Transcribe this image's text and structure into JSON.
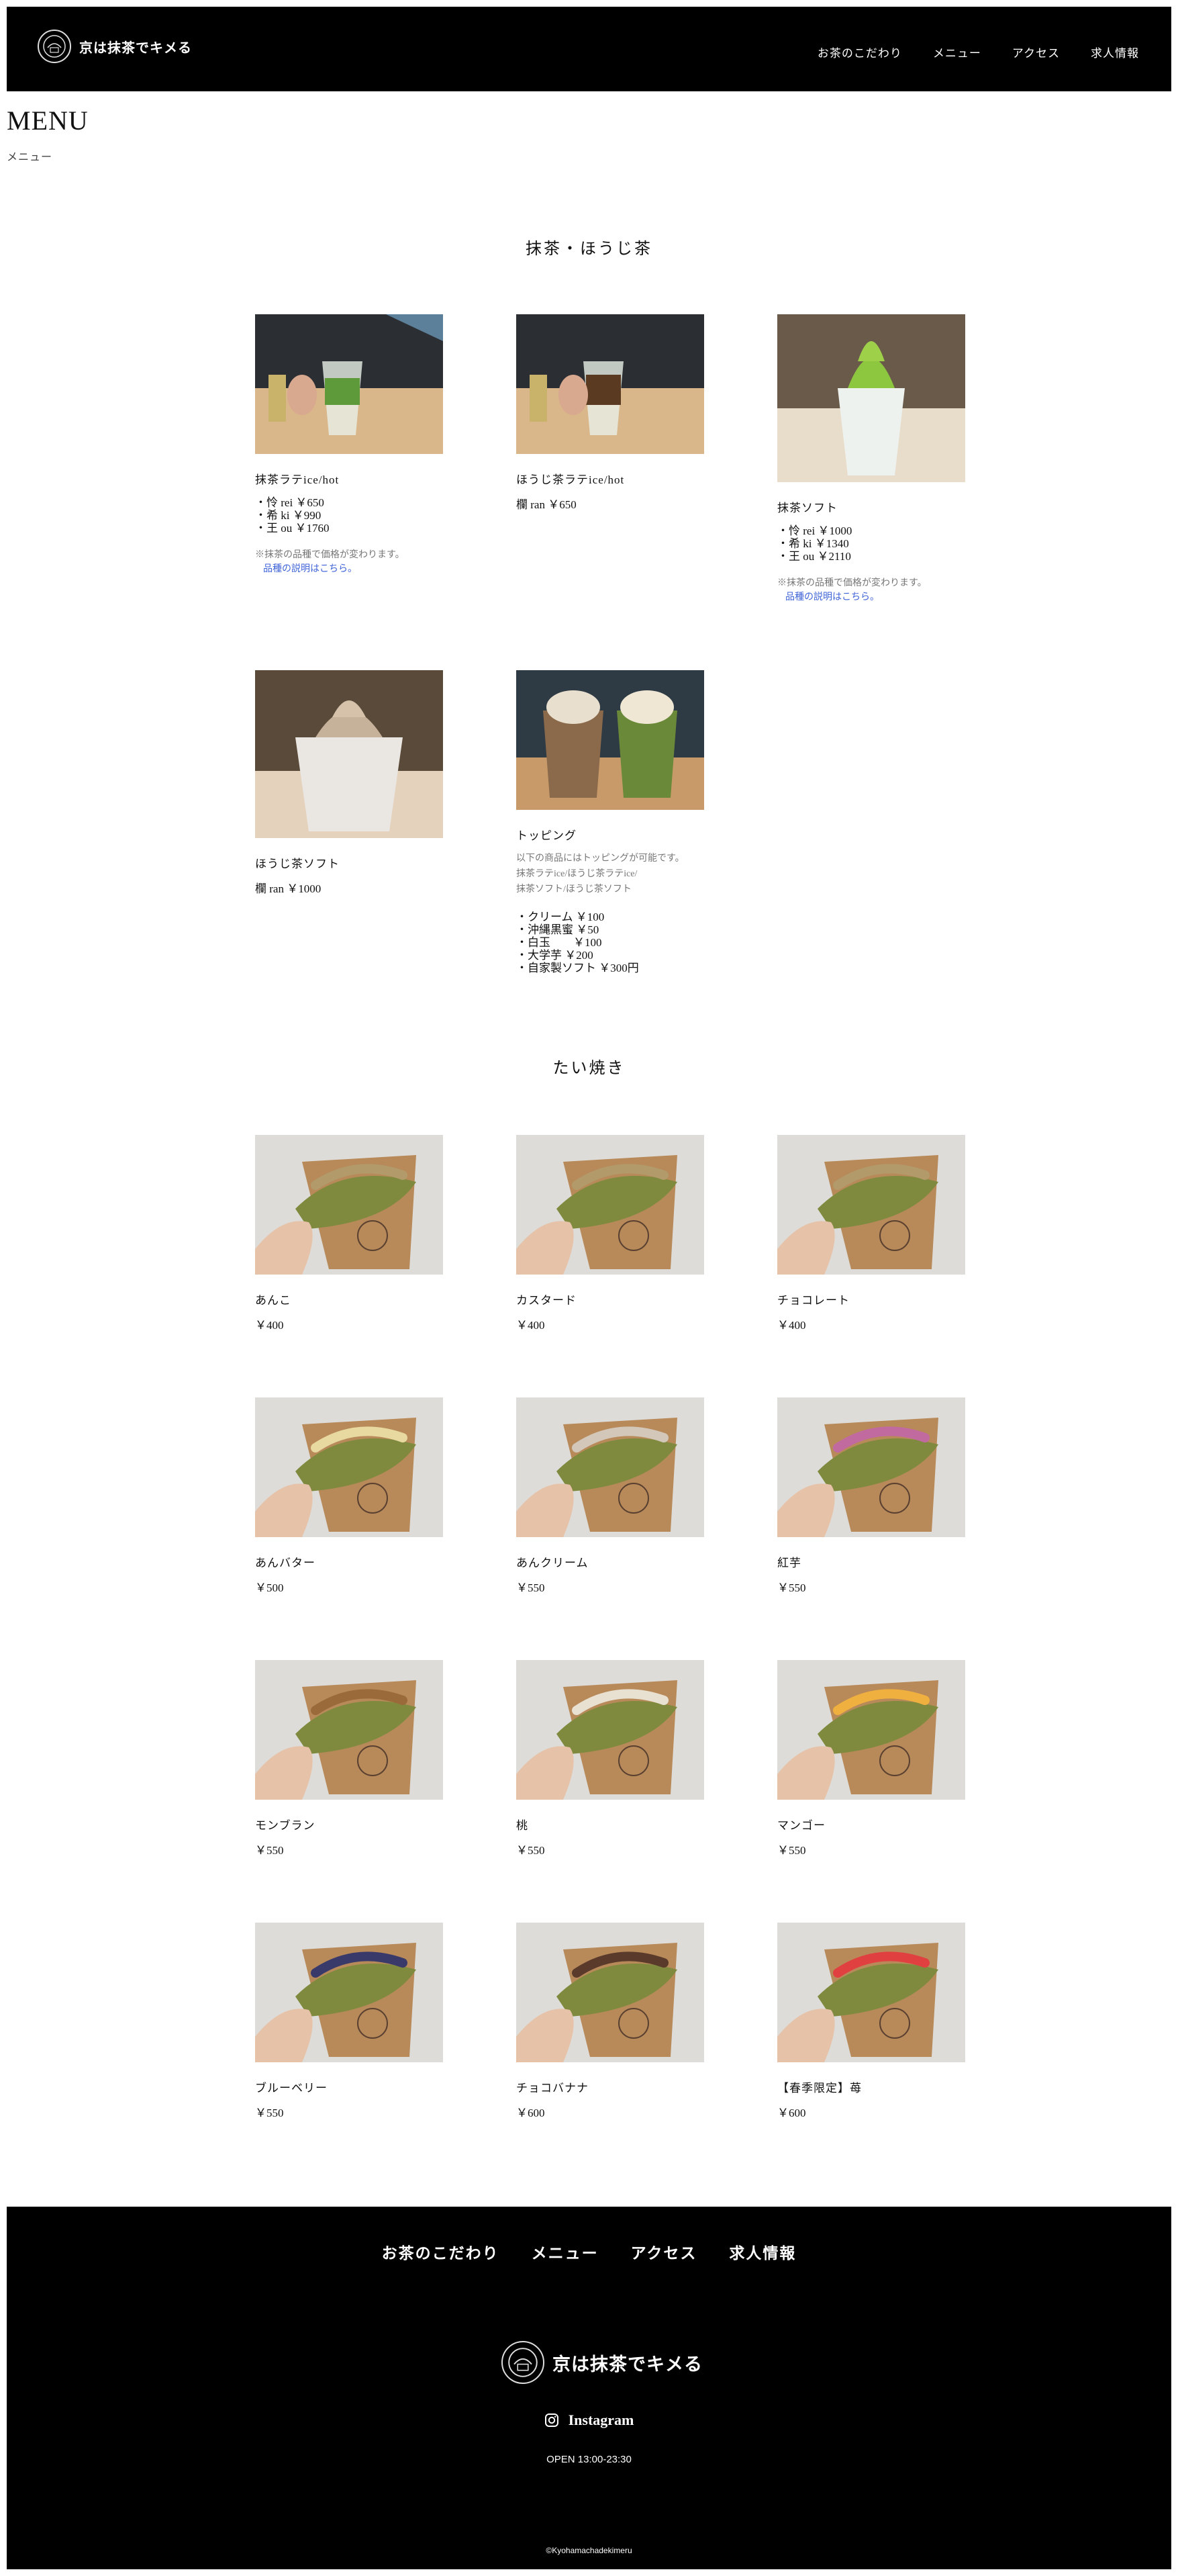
{
  "header": {
    "logo_text": "京は抹茶でキメる",
    "nav": [
      "お茶のこだわり",
      "メニュー",
      "アクセス",
      "求人情報"
    ]
  },
  "page": {
    "title": "MENU",
    "subtitle": "メニュー"
  },
  "sections": {
    "matcha": {
      "title": "抹茶・ほうじ茶",
      "items": [
        {
          "name": "抹茶ラテice/hot",
          "lines": [
            "・怜 rei ￥650",
            "・希 ki ￥990",
            "・王 ou ￥1760"
          ],
          "note": "※抹茶の品種で価格が変わります。",
          "link": "品種の説明はこちら。"
        },
        {
          "name": "ほうじ茶ラテice/hot",
          "price": "欄 ran ￥650"
        },
        {
          "name": "抹茶ソフト",
          "lines": [
            "・怜 rei ￥1000",
            "・希 ki ￥1340",
            "・王 ou ￥2110"
          ],
          "note": "※抹茶の品種で価格が変わります。",
          "link": "品種の説明はこちら。"
        },
        {
          "name": "ほうじ茶ソフト",
          "price": "欄 ran ￥1000"
        },
        {
          "name": "トッピング",
          "desc": [
            "以下の商品にはトッピングが可能です。",
            "抹茶ラテice/ほうじ茶ラテice/",
            "抹茶ソフト/ほうじ茶ソフト"
          ],
          "lines": [
            "・クリーム ￥100",
            "・沖縄黒蜜 ￥50",
            "・白玉　　￥100",
            "・大学芋 ￥200",
            "・自家製ソフト ￥300円"
          ]
        }
      ]
    },
    "taiyaki": {
      "title": "たい焼き",
      "items": [
        {
          "name": "あんこ",
          "price": "￥400"
        },
        {
          "name": "カスタード",
          "price": "￥400"
        },
        {
          "name": "チョコレート",
          "price": "￥400"
        },
        {
          "name": "あんバター",
          "price": "￥500"
        },
        {
          "name": "あんクリーム",
          "price": "￥550"
        },
        {
          "name": "紅芋",
          "price": "￥550"
        },
        {
          "name": "モンブラン",
          "price": "￥550"
        },
        {
          "name": "桃",
          "price": "￥550"
        },
        {
          "name": "マンゴー",
          "price": "￥550"
        },
        {
          "name": "ブルーベリー",
          "price": "￥550"
        },
        {
          "name": "チョコバナナ",
          "price": "￥600"
        },
        {
          "name": "【春季限定】苺",
          "price": "￥600"
        }
      ]
    }
  },
  "footer": {
    "nav": [
      "お茶のこだわり",
      "メニュー",
      "アクセス",
      "求人情報"
    ],
    "logo_text": "京は抹茶でキメる",
    "instagram": "Instagram",
    "open": "OPEN 13:00-23:30",
    "copyright": "©Kyohamachadekimeru"
  },
  "colors": {
    "header_bg": "#000000",
    "link": "#3f63d8",
    "note": "#777777"
  },
  "icons": {
    "logo": "emblem-icon",
    "instagram": "instagram-icon"
  }
}
